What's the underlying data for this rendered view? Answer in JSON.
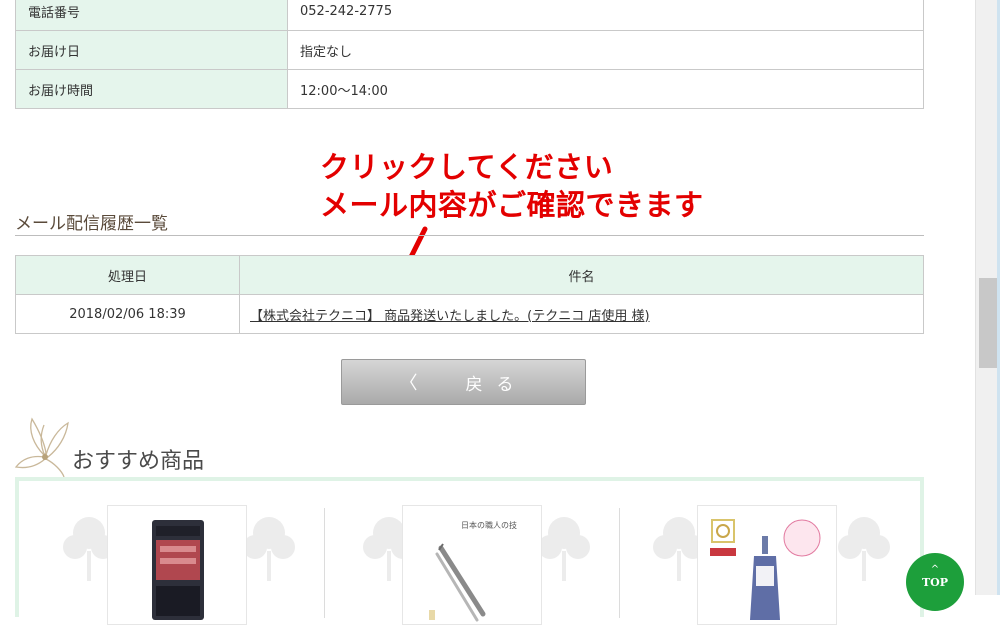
{
  "order_info": [
    {
      "label": "電話番号",
      "value": "052-242-2775"
    },
    {
      "label": "お届け日",
      "value": "指定なし"
    },
    {
      "label": "お届け時間",
      "value": "12:00～14:00"
    }
  ],
  "annotation": {
    "line1": "クリックしてください",
    "line2": "メール内容がご確認できます"
  },
  "mail_history": {
    "title": "メール配信履歴一覧",
    "columns": {
      "date": "処理日",
      "subject": "件名"
    },
    "rows": [
      {
        "date": "2018/02/06 18:39",
        "subject": "【株式会社テクニコ】 商品発送いたしました。(テクニコ 店使用 様)"
      }
    ]
  },
  "back_button": {
    "chevron": "〈",
    "label": "戻る"
  },
  "recommended": {
    "title": "おすすめ商品",
    "products": [
      {
        "image_caption": ""
      },
      {
        "image_caption": "日本の職人の技"
      },
      {
        "image_caption": ""
      }
    ]
  },
  "top_button": {
    "caret": "^",
    "label": "TOP"
  },
  "colors": {
    "accent_green": "#1d9f3b",
    "table_header_bg": "#e5f5ec",
    "annotation_red": "#e30000"
  }
}
